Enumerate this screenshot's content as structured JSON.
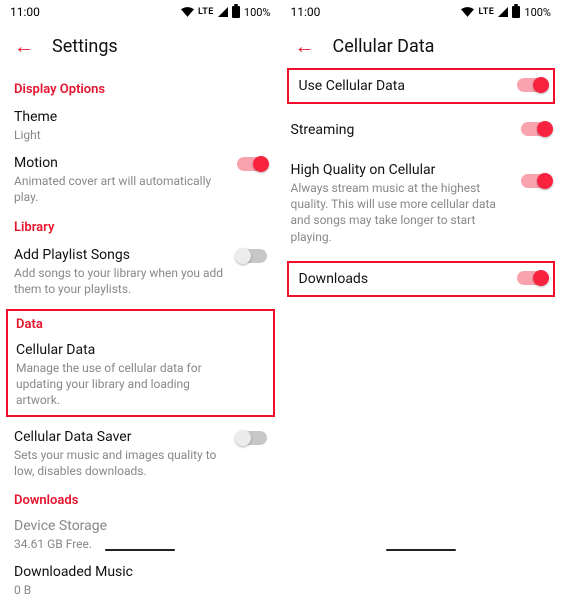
{
  "status": {
    "time": "11:00",
    "lte": "LTE",
    "battery_pct": "100%"
  },
  "left": {
    "title": "Settings",
    "sections": {
      "display": {
        "header": "Display Options",
        "theme": {
          "title": "Theme",
          "value": "Light"
        },
        "motion": {
          "title": "Motion",
          "sub": "Animated cover art will automatically play."
        }
      },
      "library": {
        "header": "Library",
        "addPlaylist": {
          "title": "Add Playlist Songs",
          "sub": "Add songs to your library when you add them to your playlists."
        }
      },
      "data": {
        "header": "Data",
        "cellular": {
          "title": "Cellular Data",
          "sub": "Manage the use of cellular data for updating your library and loading artwork."
        },
        "saver": {
          "title": "Cellular Data Saver",
          "sub": "Sets your music and images quality to low, disables downloads."
        }
      },
      "downloads": {
        "header": "Downloads",
        "storage": {
          "title": "Device Storage",
          "sub": "34.61 GB Free."
        },
        "downloaded": {
          "title": "Downloaded Music",
          "sub": "0 B"
        }
      }
    }
  },
  "right": {
    "title": "Cellular Data",
    "rows": {
      "useCellular": {
        "title": "Use Cellular Data"
      },
      "streaming": {
        "title": "Streaming"
      },
      "highQuality": {
        "title": "High Quality on Cellular",
        "sub": "Always stream music at the highest quality. This will use more cellular data and songs may take longer to start playing."
      },
      "downloads": {
        "title": "Downloads"
      }
    }
  }
}
